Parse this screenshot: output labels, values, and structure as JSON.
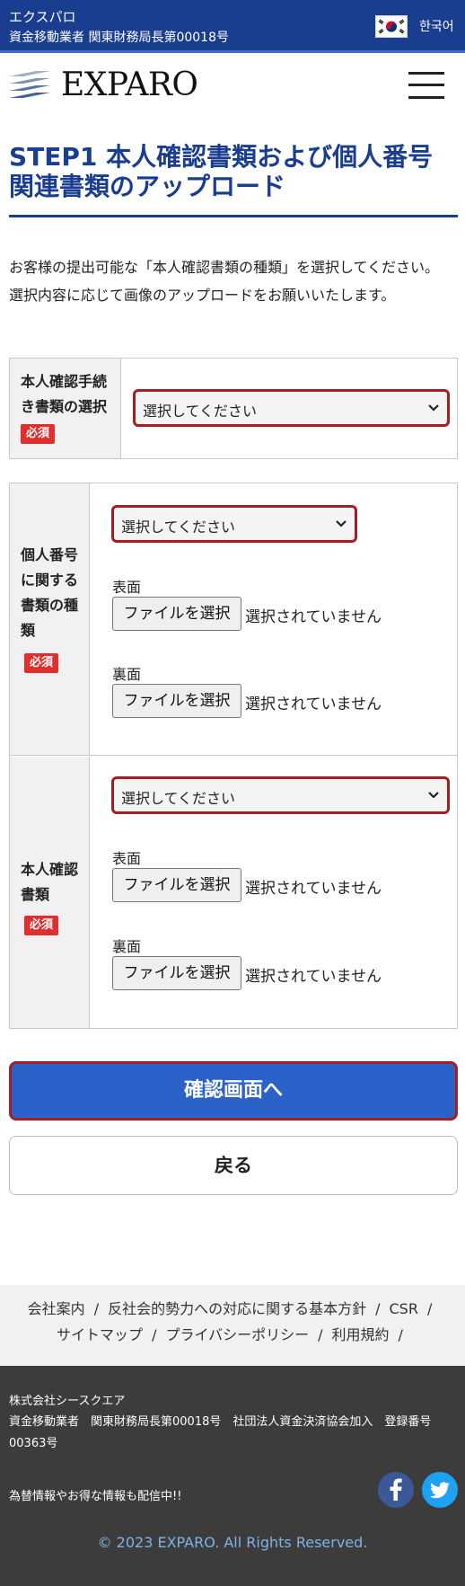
{
  "topbar": {
    "company_name": "エクスパロ",
    "registration": "資金移動業者 関東財務局長第00018号",
    "language_label": "한국어",
    "language_flag": "korea-flag-icon"
  },
  "header": {
    "logo_text": "EXPARO",
    "menu_icon": "hamburger-menu-icon"
  },
  "page": {
    "title": "STEP1 本人確認書類および個人番号関連書類のアップロード",
    "intro": [
      "お客様の提出可能な「本人確認書類の種類」を選択してください。",
      "選択内容に応じて画像のアップロードをお願いいたします。"
    ]
  },
  "form": {
    "required_badge": "必須",
    "procedure": {
      "label": "本人確認手続き書類の選択",
      "select_value": "選択してください"
    },
    "mynumber": {
      "label": "個人番号に関する書類の種類",
      "select_value": "選択してください",
      "front_label": "表面",
      "back_label": "裏面",
      "file_button": "ファイルを選択",
      "file_status": "選択されていません"
    },
    "identity": {
      "label": "本人確認書類",
      "select_value": "選択してください",
      "front_label": "表面",
      "back_label": "裏面",
      "file_button": "ファイルを選択",
      "file_status": "選択されていません"
    }
  },
  "actions": {
    "confirm_label": "確認画面へ",
    "back_label": "戻る"
  },
  "footer_links": {
    "items": [
      "会社案内",
      "反社会的勢力への対応に関する基本方針",
      "CSR",
      "サイトマップ",
      "プライバシーポリシー",
      "利用規約"
    ],
    "separator": "/"
  },
  "footer": {
    "company": "株式会社シースクエア",
    "registration": "資金移動業者　関東財務局長第00018号　社団法人資金決済協会加入　登録番号00363号",
    "news": "為替情報やお得な情報も配信中!!",
    "facebook_icon": "facebook-icon",
    "twitter_icon": "twitter-icon",
    "copyright": "© 2023 EXPARO. All Rights Reserved."
  },
  "colors": {
    "brand_navy": "#1a3e8f",
    "primary_button": "#2a62c9",
    "highlight_border": "#a81c22",
    "required_badge": "#e02d2d",
    "footer_bg": "#3c3c3c",
    "copyright_text": "#7fb3e6",
    "facebook": "#3b5998",
    "twitter": "#1da1f2"
  }
}
